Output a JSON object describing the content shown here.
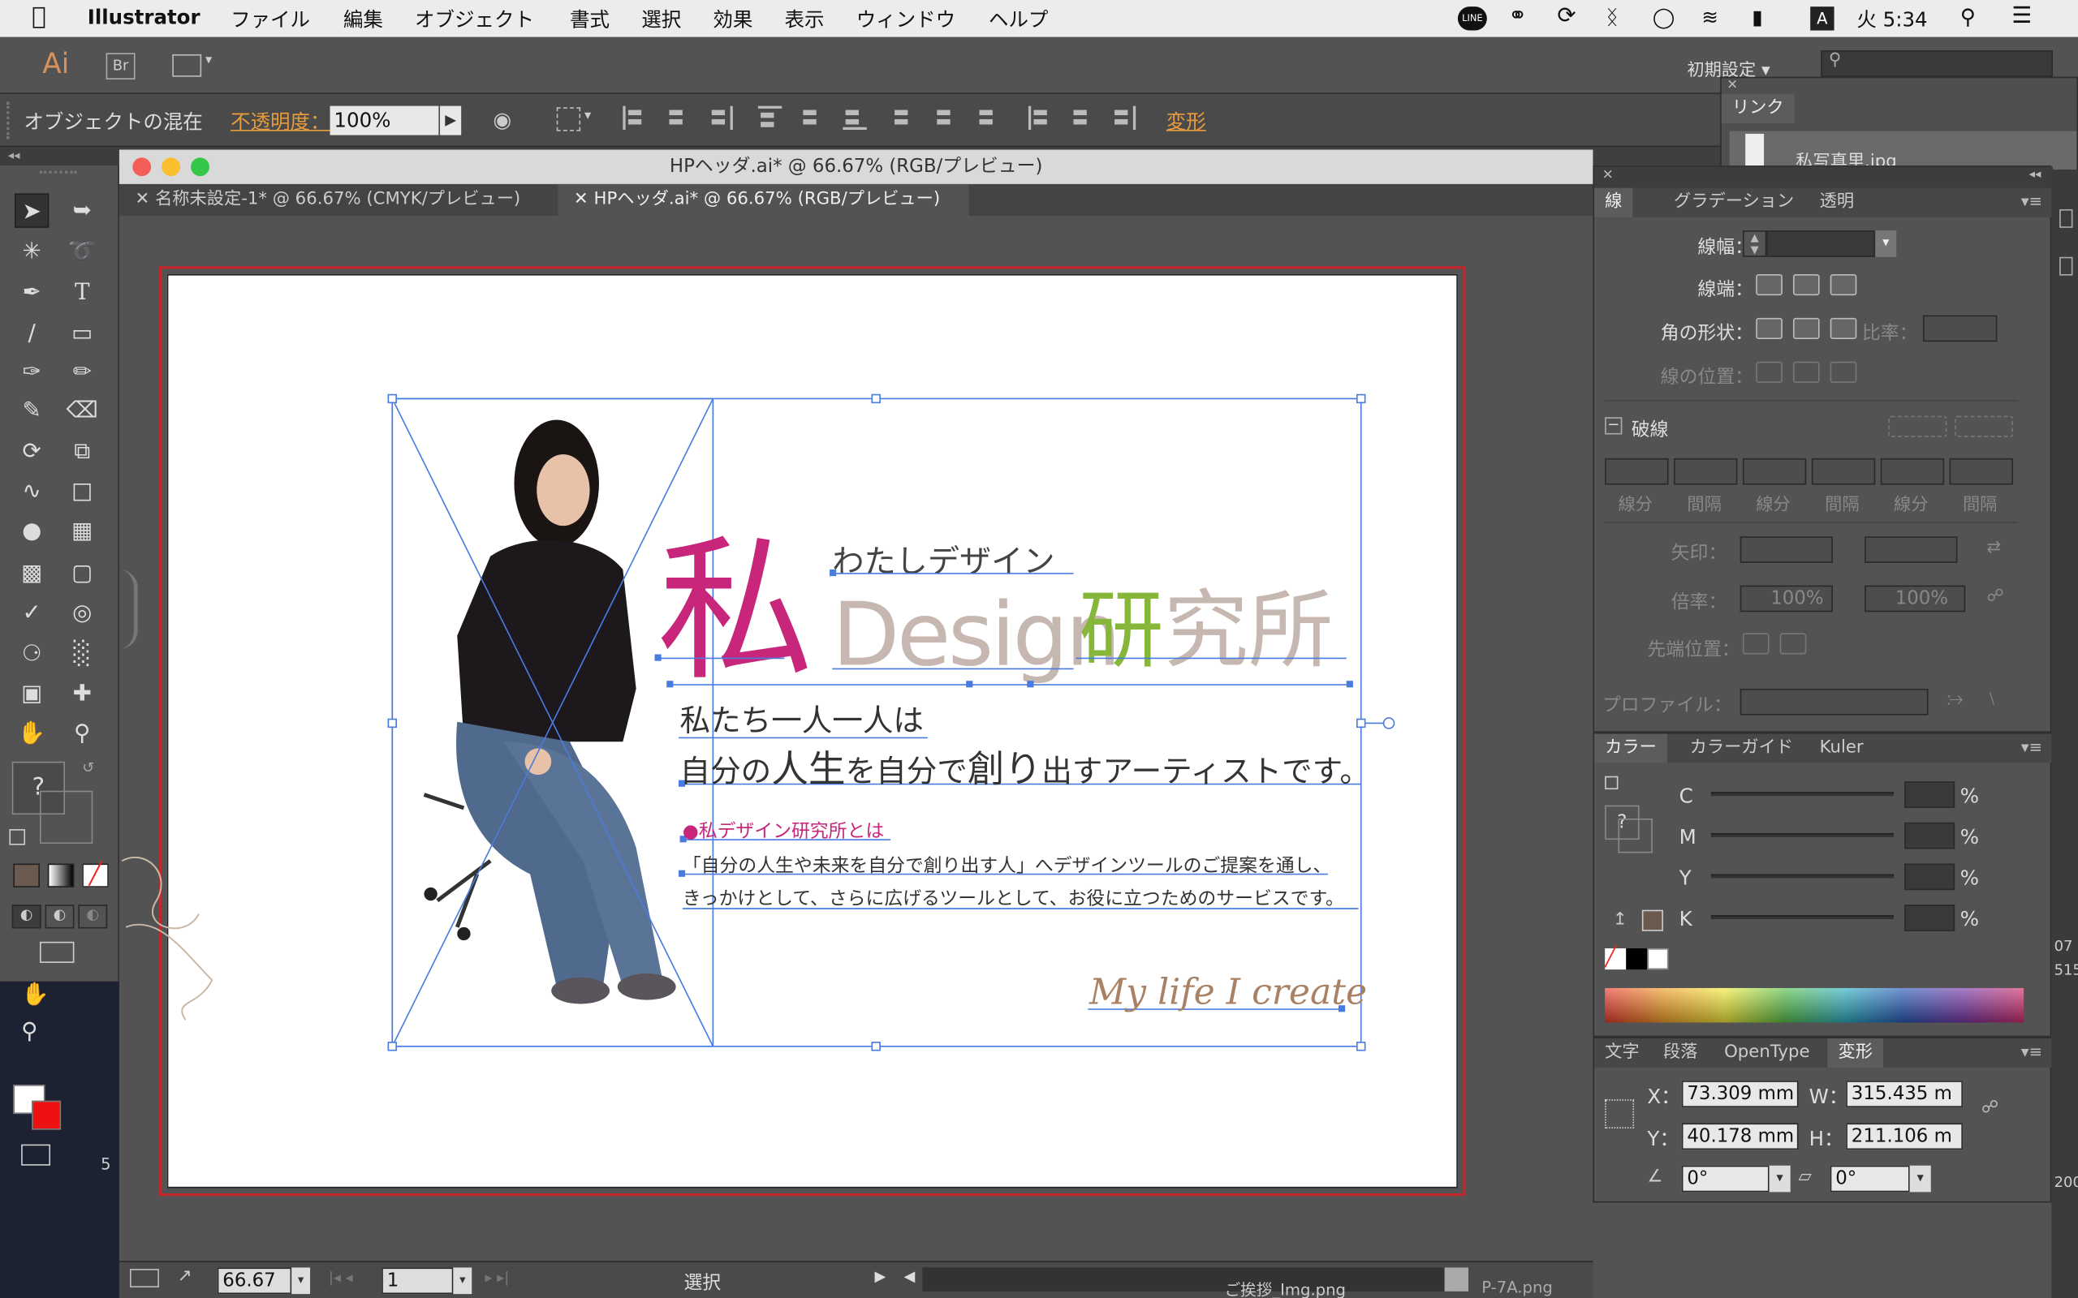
{
  "menubar": {
    "app": "Illustrator",
    "items": [
      "ファイル",
      "編集",
      "オブジェクト",
      "書式",
      "選択",
      "効果",
      "表示",
      "ウィンドウ",
      "ヘルプ"
    ],
    "clock": "火 5:34",
    "line": "LINE",
    "a_badge": "A"
  },
  "apptool": {
    "logo": "Ai",
    "bridge": "Br",
    "workspace": "初期設定 ▾"
  },
  "control": {
    "label": "オブジェクトの混在",
    "opacity_label": "不透明度：",
    "opacity_value": "100%",
    "transform_link": "変形"
  },
  "document": {
    "window_title": "HPヘッダ.ai* @ 66.67% (RGB/プレビュー)",
    "tabs": [
      "名称未設定-1* @ 66.67% (CMYK/プレビュー)",
      "HPヘッダ.ai* @ 66.67% (RGB/プレビュー)"
    ]
  },
  "artwork": {
    "kanji": "私",
    "sub": "わたしデザイン",
    "design": "Design",
    "kenkyujo": "研究所",
    "line1": "私たち一人一人は",
    "line2_a": "自分の",
    "line2_b": "人生",
    "line2_c": "を自分で",
    "line2_d": "創り",
    "line2_e": "出すアーティストです。",
    "bullet": "●私デザイン研究所とは",
    "desc1": "「自分の人生や未来を自分で創り出す人」へデザインツールのご提案を通し、",
    "desc2": "きっかけとして、さらに広げるツールとして、お役に立つためのサービスです。",
    "script": "My life I create",
    "colors": {
      "kanji": "#c8267a",
      "design": "#c6b7b1",
      "g": "#3a8fd0",
      "kenkyu": "#86b63a",
      "sho": "#c6b7b1"
    }
  },
  "links_panel": {
    "title": "リンク",
    "file": "私写真里.jpg"
  },
  "stroke_panel": {
    "tabs": [
      "線",
      "グラデーション",
      "透明"
    ],
    "weight": "線幅：",
    "cap": "線端：",
    "corner": "角の形状：",
    "ratio": "比率：",
    "align": "線の位置：",
    "dashed": "破線",
    "dash_labels": [
      "線分",
      "間隔",
      "線分",
      "間隔",
      "線分",
      "間隔"
    ],
    "arrow": "矢印：",
    "scale": "倍率：",
    "scale_v1": "100%",
    "scale_v2": "100%",
    "tip": "先端位置：",
    "profile": "プロファイル："
  },
  "color_panel": {
    "tabs": [
      "カラー",
      "カラーガイド",
      "Kuler"
    ],
    "channels": [
      "C",
      "M",
      "Y",
      "K"
    ],
    "pct": "%"
  },
  "transform_panel": {
    "tabs": [
      "文字",
      "段落",
      "OpenType",
      "変形"
    ],
    "x_label": "X：",
    "x": "73.309 mm",
    "y_label": "Y：",
    "y": "40.178 mm",
    "w_label": "W：",
    "w": "315.435 m",
    "h_label": "H：",
    "h": "211.106 m",
    "angle": "0°",
    "shear": "0°"
  },
  "status": {
    "zoom": "66.67",
    "page": "1",
    "mode": "選択",
    "file_a": "ご挨拶_Img.png",
    "file_b": "P-7A.png"
  },
  "side_edge": {
    "t1": "07",
    "t2": "515",
    "t3": "200",
    "t4": "5"
  },
  "tools": {
    "unknown": "?"
  }
}
